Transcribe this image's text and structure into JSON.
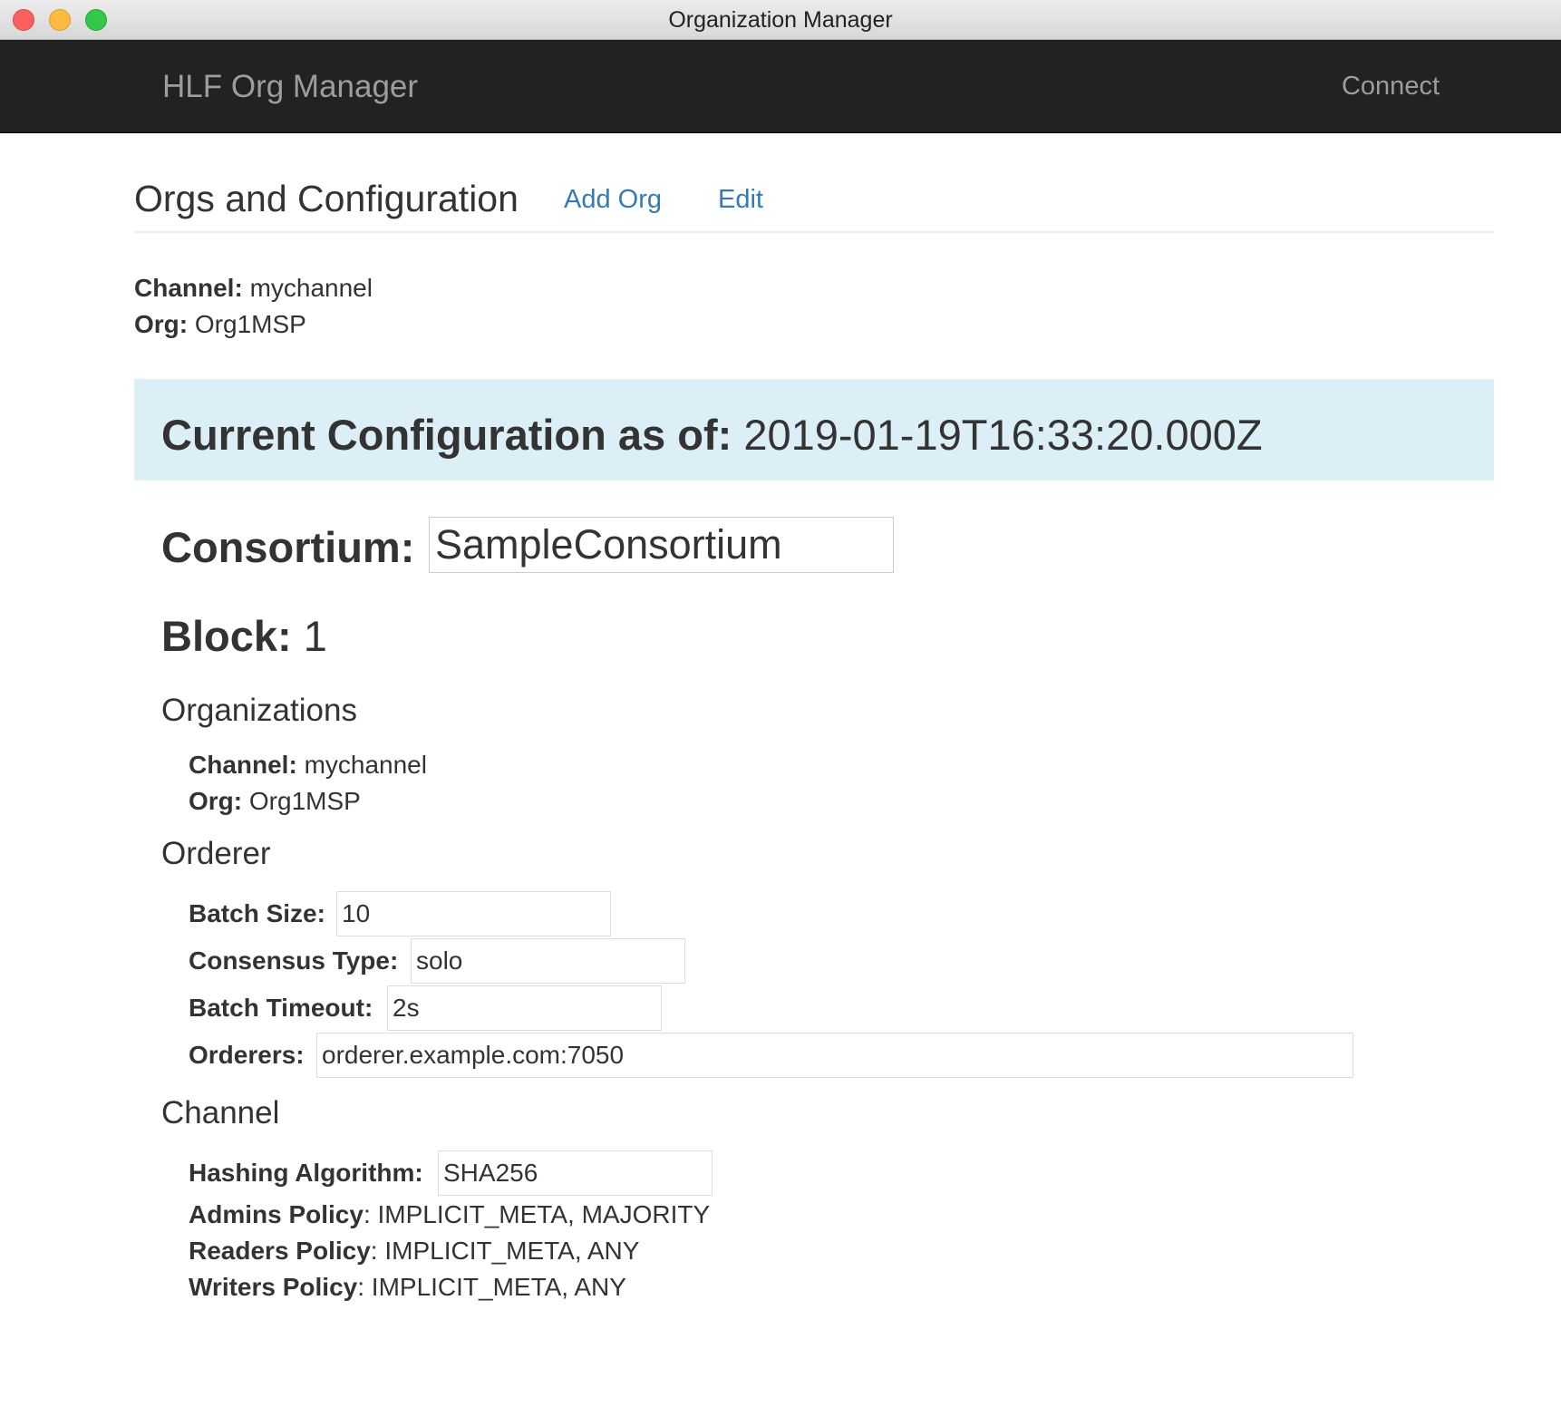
{
  "window": {
    "title": "Organization Manager"
  },
  "navbar": {
    "brand": "HLF Org Manager",
    "connect_label": "Connect"
  },
  "header": {
    "title": "Orgs and Configuration",
    "add_org_label": "Add Org",
    "edit_label": "Edit"
  },
  "summary": {
    "channel_label": "Channel:",
    "channel_value": "mychannel",
    "org_label": "Org:",
    "org_value": "Org1MSP"
  },
  "config": {
    "heading_label": "Current Configuration as of:",
    "timestamp": "2019-01-19T16:33:20.000Z",
    "consortium_label": "Consortium:",
    "consortium_value": "SampleConsortium",
    "block_label": "Block:",
    "block_value": "1"
  },
  "organizations": {
    "heading": "Organizations",
    "channel_label": "Channel:",
    "channel_value": "mychannel",
    "org_label": "Org:",
    "org_value": "Org1MSP"
  },
  "orderer": {
    "heading": "Orderer",
    "batch_size_label": "Batch Size:",
    "batch_size_value": "10",
    "consensus_type_label": "Consensus Type:",
    "consensus_type_value": "solo",
    "batch_timeout_label": "Batch Timeout:",
    "batch_timeout_value": "2s",
    "orderers_label": "Orderers:",
    "orderers_value": "orderer.example.com:7050"
  },
  "channel": {
    "heading": "Channel",
    "hashing_label": "Hashing Algorithm:",
    "hashing_value": "SHA256",
    "admins_label": "Admins Policy",
    "admins_value": ": IMPLICIT_META, MAJORITY",
    "readers_label": "Readers Policy",
    "readers_value": ": IMPLICIT_META, ANY",
    "writers_label": "Writers Policy",
    "writers_value": ": IMPLICIT_META, ANY"
  },
  "colors": {
    "navbar_bg": "#222222",
    "link": "#337ab7",
    "jumbotron_bg": "#dceef6"
  }
}
